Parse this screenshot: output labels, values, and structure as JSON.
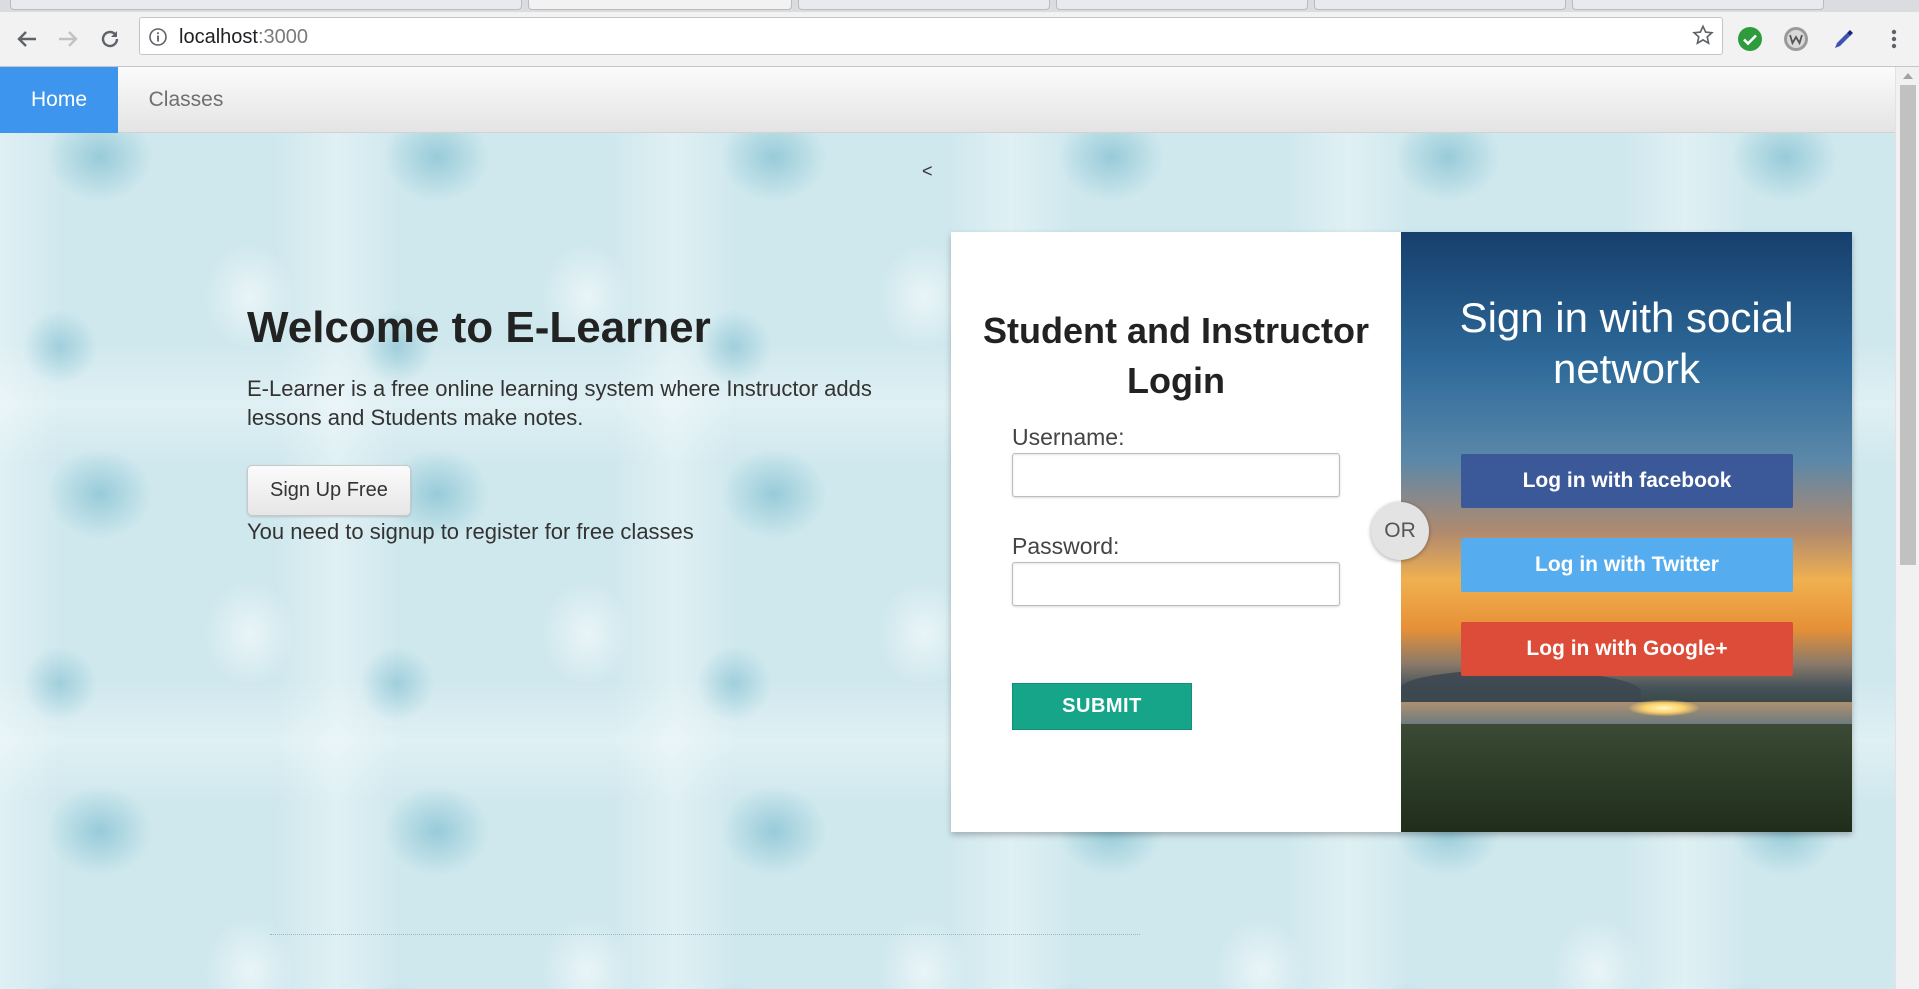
{
  "browser": {
    "url_host": "localhost",
    "url_port": ":3000"
  },
  "navbar": {
    "home_label": "Home",
    "classes_label": "Classes"
  },
  "stray_char": "<",
  "hero": {
    "title": "Welcome to E-Learner",
    "description": "E-Learner is a free online learning system where Instructor adds lessons and Students make notes.",
    "signup_label": "Sign Up Free",
    "signup_note": "You need to signup to register for free classes"
  },
  "login": {
    "title": "Student and Instructor Login",
    "username_label": "Username:",
    "password_label": "Password:",
    "submit_label": "SUBMIT"
  },
  "divider_label": "OR",
  "social": {
    "title": "Sign in with social network",
    "facebook_label": "Log in with facebook",
    "twitter_label": "Log in with Twitter",
    "google_label": "Log in with Google+"
  },
  "colors": {
    "home_active": "#3d95ee",
    "submit": "#17a589",
    "facebook": "#3b5998",
    "twitter": "#55acee",
    "google": "#dd4b39"
  }
}
